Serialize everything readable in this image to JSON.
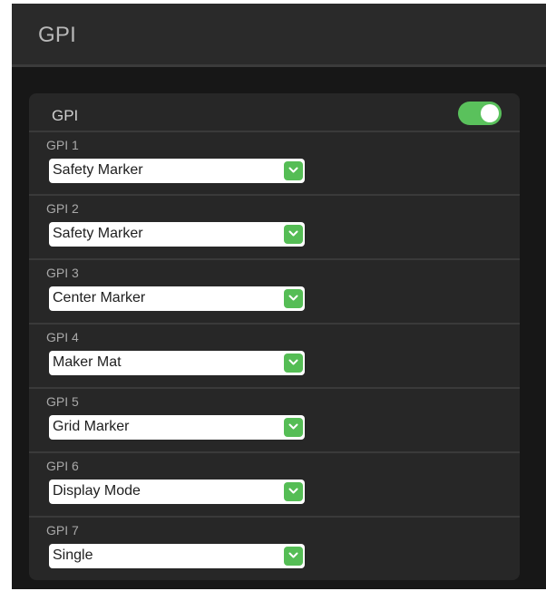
{
  "header": {
    "title": "GPI"
  },
  "panel": {
    "title": "GPI",
    "enabled": true,
    "accent_color": "#5ac15c",
    "rows": [
      {
        "label": "GPI 1",
        "value": "Safety Marker"
      },
      {
        "label": "GPI 2",
        "value": "Safety Marker"
      },
      {
        "label": "GPI 3",
        "value": "Center Marker"
      },
      {
        "label": "GPI 4",
        "value": "Maker Mat"
      },
      {
        "label": "GPI 5",
        "value": "Grid Marker"
      },
      {
        "label": "GPI 6",
        "value": "Display Mode"
      },
      {
        "label": "GPI 7",
        "value": "Single"
      }
    ]
  },
  "icons": {
    "dropdown": "chevron-down-icon"
  }
}
